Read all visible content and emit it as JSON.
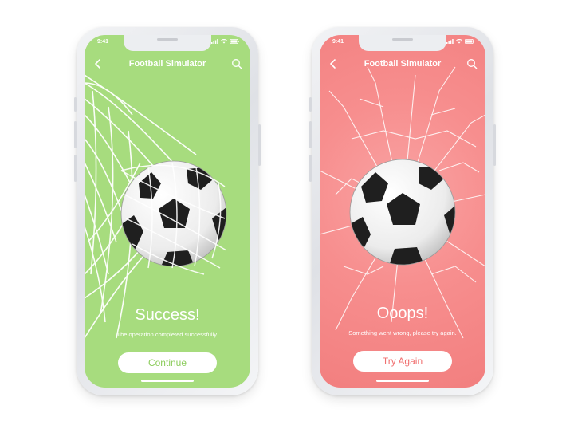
{
  "screens": [
    {
      "status_time": "9:41",
      "nav_title": "Football Simulator",
      "result_title": "Success!",
      "result_message": "The operation completed successfully.",
      "action_label": "Continue",
      "background_color": "#a7dc7e",
      "action_text_color": "#8ccc5c"
    },
    {
      "status_time": "9:41",
      "nav_title": "Football Simulator",
      "result_title": "Ooops!",
      "result_message": "Something went wrong, please try again.",
      "action_label": "Try Again",
      "background_color": "#f78e8e",
      "action_text_color": "#f07070"
    }
  ],
  "icons": {
    "back": "chevron-left-icon",
    "search": "search-icon",
    "signal": "cellular-signal-icon",
    "wifi": "wifi-icon",
    "battery": "battery-icon"
  }
}
